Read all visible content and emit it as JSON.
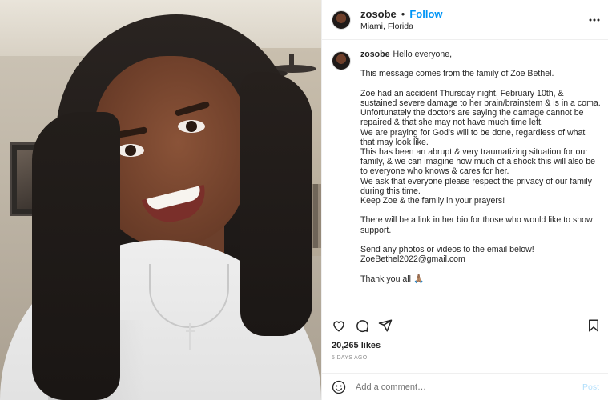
{
  "header": {
    "username": "zosobe",
    "separator": "•",
    "follow_label": "Follow",
    "location": "Miami, Florida",
    "more_icon": "more-horizontal-icon"
  },
  "caption": {
    "username": "zosobe",
    "greeting": "Hello everyone,",
    "paragraphs": [
      "This message comes from the family of Zoe Bethel.",
      "Zoe had an accident Thursday night, February 10th, & sustained severe damage to her brain/brainstem & is in a coma.",
      "Unfortunately the doctors are saying the damage cannot be repaired & that she may not have much time left.",
      "We are praying for God's will to be done, regardless of what that may look like.",
      "This has been an abrupt & very traumatizing situation for our family, & we can imagine how much of a shock this will also be to everyone who knows & cares for her.",
      "We ask that everyone please respect the privacy of our family during this time.",
      "Keep Zoe & the family in your prayers!",
      "There will be a link in her bio for those who would like to show support.",
      "Send any photos or videos to the email below!",
      "ZoeBethel2022@gmail.com",
      "Thank you all 🙏🏽"
    ]
  },
  "actions": {
    "like_icon": "heart-icon",
    "comment_icon": "comment-icon",
    "share_icon": "send-icon",
    "save_icon": "bookmark-icon"
  },
  "likes": "20,265 likes",
  "time_ago": "5 DAYS AGO",
  "comment": {
    "emoji_icon": "smiley-icon",
    "placeholder": "Add a comment…",
    "post_label": "Post"
  },
  "colors": {
    "accent": "#0095f6",
    "text": "#262626",
    "muted": "#8e8e8e",
    "post_disabled": "#b2dffc",
    "border": "#efefef"
  }
}
